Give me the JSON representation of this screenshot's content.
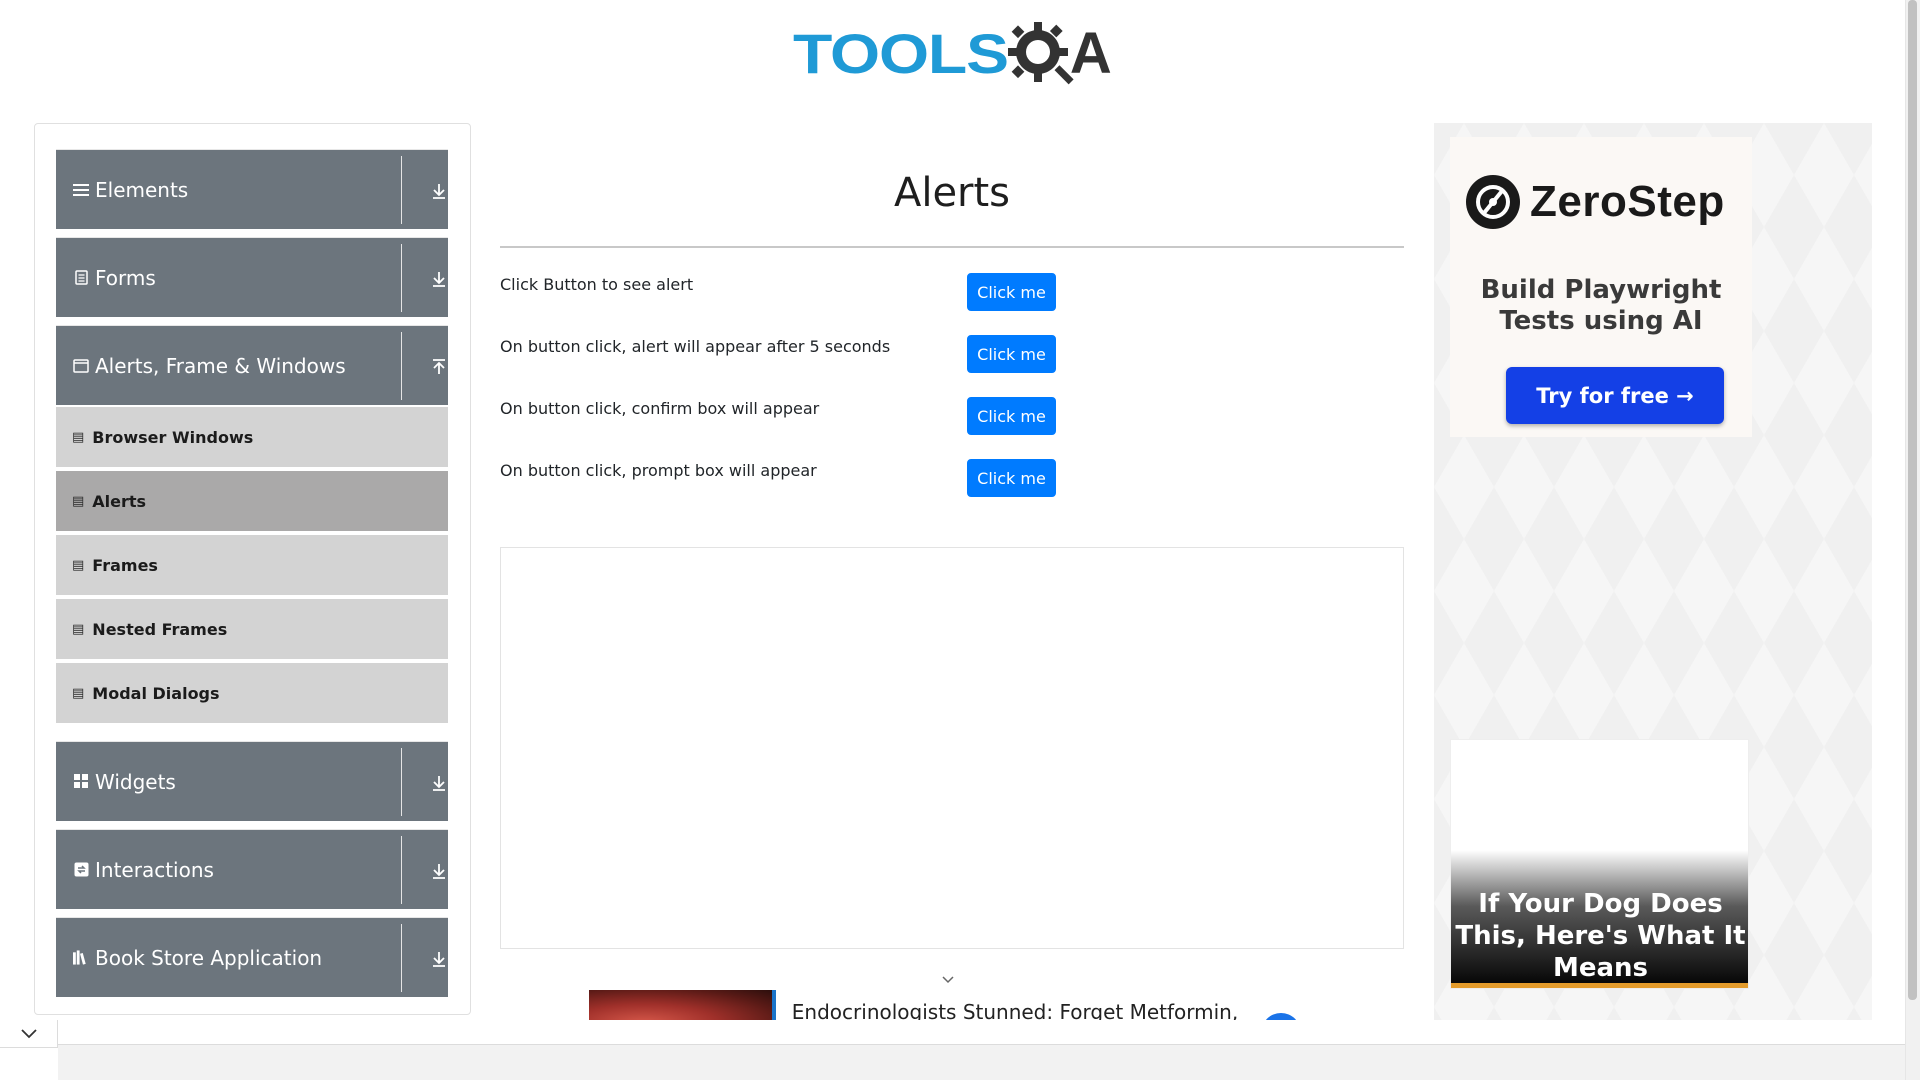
{
  "brand": {
    "logo_left": "TOOLS",
    "logo_right": "A"
  },
  "sidebar": {
    "groups": [
      {
        "label": "Elements",
        "icon": "hamburger-icon",
        "expanded": false
      },
      {
        "label": "Forms",
        "icon": "document-icon",
        "expanded": false
      },
      {
        "label": "Alerts, Frame & Windows",
        "icon": "window-icon",
        "expanded": true
      },
      {
        "label": "Widgets",
        "icon": "grid-icon",
        "expanded": false
      },
      {
        "label": "Interactions",
        "icon": "interaction-icon",
        "expanded": false
      },
      {
        "label": "Book Store Application",
        "icon": "books-icon",
        "expanded": false
      }
    ],
    "items": [
      {
        "label": "Browser Windows",
        "active": false
      },
      {
        "label": "Alerts",
        "active": true
      },
      {
        "label": "Frames",
        "active": false
      },
      {
        "label": "Nested Frames",
        "active": false
      },
      {
        "label": "Modal Dialogs",
        "active": false
      }
    ]
  },
  "main": {
    "title": "Alerts",
    "rows": [
      {
        "label": "Click Button to see alert",
        "button": "Click me"
      },
      {
        "label": "On button click, alert will appear after 5 seconds",
        "button": "Click me"
      },
      {
        "label": "On button click, confirm box will appear",
        "button": "Click me"
      },
      {
        "label": "On button click, prompt box will appear",
        "button": "Click me"
      }
    ]
  },
  "right_ad": {
    "brand": "ZeroStep",
    "tagline": "Build Playwright Tests using AI",
    "cta": "Try for free →"
  },
  "dog_ad": {
    "headline": "If Your Dog Does This, Here's What It Means"
  },
  "bottom_banner": {
    "text": "Endocrinologists Stunned: Forget Metformin, This \"Fixes\" Your Diabetes! Try It!",
    "go": ">"
  },
  "colors": {
    "brand_blue": "#1f9ad6",
    "sidebar_header": "#6c757d",
    "menu_item": "#d3d3d3",
    "menu_item_active": "#aaa9a9",
    "button": "#007bff",
    "cta": "#1440e6"
  }
}
